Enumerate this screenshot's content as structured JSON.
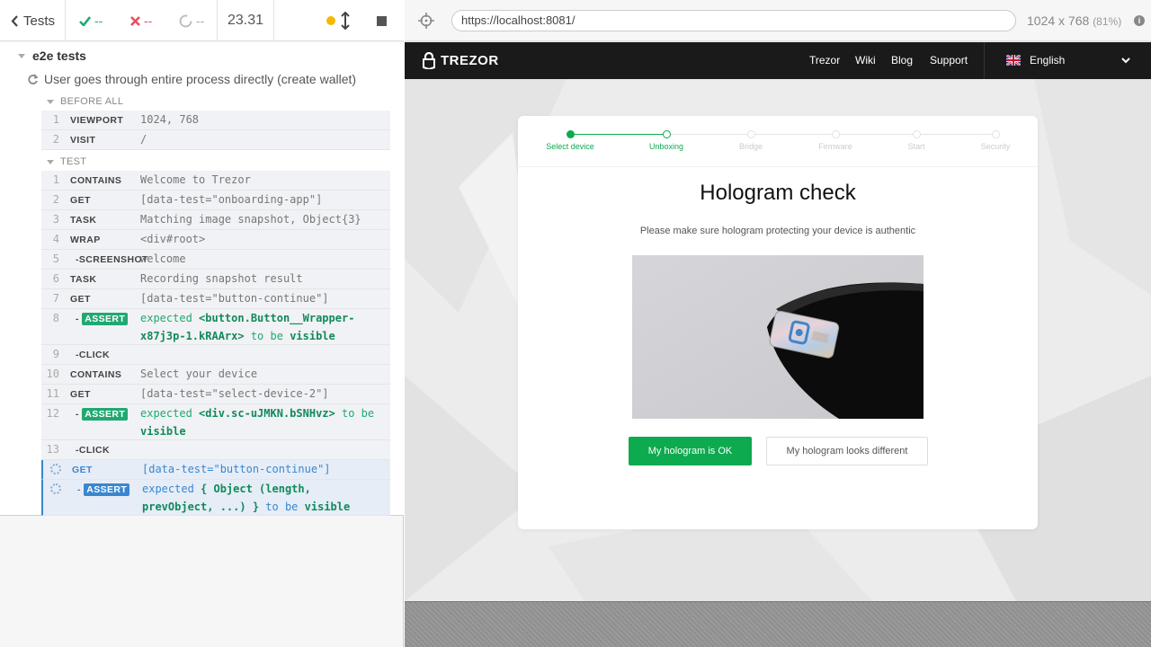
{
  "reporter": {
    "header": {
      "tests_label": "Tests",
      "passed": "--",
      "failed": "--",
      "pending": "--",
      "duration": "23.31"
    },
    "suite": "e2e tests",
    "test": "User goes through entire process directly (create wallet)",
    "hooks": {
      "before_all": "BEFORE ALL",
      "test": "TEST"
    },
    "before_all_cmds": [
      {
        "num": "1",
        "name": "VIEWPORT",
        "msg": "1024, 768"
      },
      {
        "num": "2",
        "name": "VISIT",
        "msg": "/"
      }
    ],
    "test_cmds": [
      {
        "num": "1",
        "name": "CONTAINS",
        "msg": "Welcome to Trezor"
      },
      {
        "num": "2",
        "name": "GET",
        "msg": "[data-test=\"onboarding-app\"]"
      },
      {
        "num": "3",
        "name": "TASK",
        "msg": "Matching image snapshot, Object{3}"
      },
      {
        "num": "4",
        "name": "WRAP",
        "msg": "<div#root>"
      },
      {
        "num": "5",
        "name": "-SCREENSHOT",
        "msg": "welcome"
      },
      {
        "num": "6",
        "name": "TASK",
        "msg": "Recording snapshot result"
      },
      {
        "num": "7",
        "name": "GET",
        "msg": "[data-test=\"button-continue\"]"
      },
      {
        "num": "8",
        "name": "ASSERT",
        "prefix": "expected",
        "subject": "<button.Button__Wrapper-x87j3p-1.kRAArx>",
        "mid": "to be",
        "object": "visible"
      },
      {
        "num": "9",
        "name": "-CLICK",
        "msg": ""
      },
      {
        "num": "10",
        "name": "CONTAINS",
        "msg": "Select your device"
      },
      {
        "num": "11",
        "name": "GET",
        "msg": "[data-test=\"select-device-2\"]"
      },
      {
        "num": "12",
        "name": "ASSERT",
        "prefix": "expected",
        "subject": "<div.sc-uJMKN.bSNHvz>",
        "mid": "to be",
        "object": "visible"
      },
      {
        "num": "13",
        "name": "-CLICK",
        "msg": ""
      },
      {
        "num": "",
        "name": "GET",
        "msg": "[data-test=\"button-continue\"]"
      },
      {
        "num": "",
        "name": "ASSERT",
        "prefix": "expected",
        "subject": "{ Object (length, prevObject, ...) }",
        "mid": "to be",
        "object": "visible"
      }
    ]
  },
  "runner": {
    "url": "https://localhost:8081/",
    "viewport": "1024 x 768",
    "scale": "(81%)"
  },
  "app": {
    "brand": "TREZOR",
    "nav": [
      "Trezor",
      "Wiki",
      "Blog",
      "Support"
    ],
    "language": "English",
    "steps": [
      "Select device",
      "Unboxing",
      "Bridge",
      "Firmware",
      "Start",
      "Security"
    ],
    "active_step": 1,
    "heading": "Hologram check",
    "subheading": "Please make sure hologram protecting your device is authentic",
    "btn_ok": "My hologram is OK",
    "btn_diff": "My hologram looks different",
    "colors": {
      "accent": "#0eaa4f",
      "running": "#3a87d0",
      "passed": "#1fa971",
      "failed": "#e94f5c"
    }
  }
}
